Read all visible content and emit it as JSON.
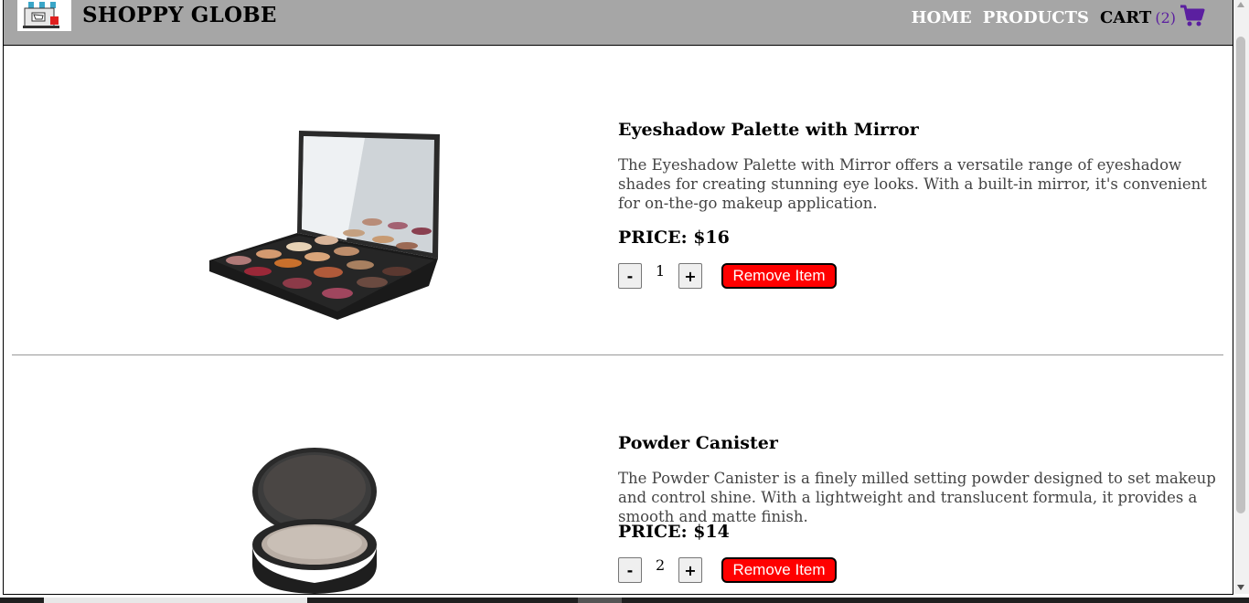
{
  "header": {
    "brand": "SHOPPY GLOBE",
    "nav": {
      "home": "HOME",
      "products": "PRODUCTS",
      "cart": "CART",
      "cart_count": "(2)"
    }
  },
  "cart_items": [
    {
      "title": "Eyeshadow Palette with Mirror",
      "description": "The Eyeshadow Palette with Mirror offers a versatile range of eyeshadow shades for creating stunning eye looks. With a built-in mirror, it's convenient for on-the-go makeup application.",
      "price": "PRICE: $16",
      "quantity": "1",
      "minus": "-",
      "plus": "+",
      "remove": "Remove Item"
    },
    {
      "title": "Powder Canister",
      "description": "The Powder Canister is a finely milled setting powder designed to set makeup and control shine. With a lightweight and translucent formula, it provides a smooth and matte finish.",
      "price": "PRICE: $14",
      "quantity": "2",
      "minus": "-",
      "plus": "+",
      "remove": "Remove Item"
    }
  ],
  "colors": {
    "header_bg": "#a6a6a6",
    "remove_button": "#ff0000",
    "cart_icon": "#5b1fa0"
  }
}
